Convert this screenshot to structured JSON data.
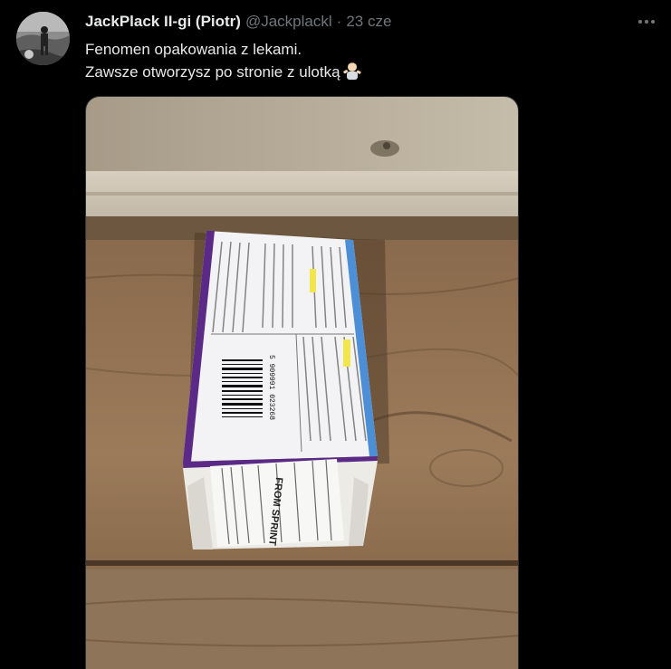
{
  "tweet": {
    "display_name": "JackPlack II-gi (Piotr)",
    "handle": "@Jackplackl",
    "separator": "·",
    "time": "23 cze",
    "line1": "Fenomen opakowania z lekami.",
    "line2": "Zawsze otworzysz po stronie z ulotką",
    "emoji": "man-shrugging-emoji"
  },
  "media": {
    "box_label_top": "FROM SPRINT",
    "barcode_digits": "5 909991 023268"
  },
  "colors": {
    "background": "#000000",
    "text_primary": "#e7e9ea",
    "text_secondary": "#71767b",
    "box_accent": "#5b2a86"
  }
}
